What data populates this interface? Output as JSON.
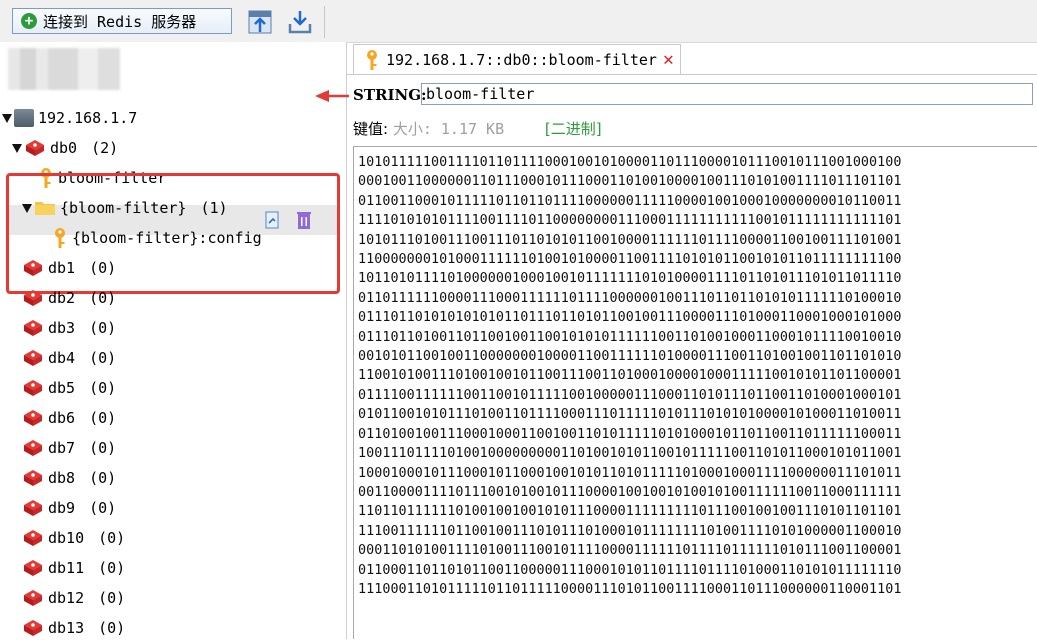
{
  "toolbar": {
    "connect_label": "连接到 Redis 服务器",
    "icons": [
      "plus-circle-icon",
      "import-icon",
      "export-icon"
    ]
  },
  "tree": {
    "server": "192.168.1.7",
    "databases": [
      {
        "name": "db0",
        "count": "(2)"
      },
      {
        "name": "db1",
        "count": "(0)"
      },
      {
        "name": "db2",
        "count": "(0)"
      },
      {
        "name": "db3",
        "count": "(0)"
      },
      {
        "name": "db4",
        "count": "(0)"
      },
      {
        "name": "db5",
        "count": "(0)"
      },
      {
        "name": "db6",
        "count": "(0)"
      },
      {
        "name": "db7",
        "count": "(0)"
      },
      {
        "name": "db8",
        "count": "(0)"
      },
      {
        "name": "db9",
        "count": "(0)"
      },
      {
        "name": "db10",
        "count": "(0)"
      },
      {
        "name": "db11",
        "count": "(0)"
      },
      {
        "name": "db12",
        "count": "(0)"
      },
      {
        "name": "db13",
        "count": "(0)"
      }
    ],
    "key_item": "bloom-filter",
    "folder_item": "{bloom-filter}",
    "folder_count": "(1)",
    "sub_key_item": "{bloom-filter}:config"
  },
  "tab": {
    "title": "192.168.1.7::db0::bloom-filter",
    "close": "✕"
  },
  "detail": {
    "type_label": "STRING:",
    "key_value": "bloom-filter",
    "value_label": "键值:",
    "size_text": "大小: 1.17 KB",
    "format_link": "[二进制]"
  },
  "value_lines": [
    "1010111110011110110111100010010100001101110000101110010111001000100",
    "0001001100000011011100010111000110100100001001110101001111011101101",
    "0110011000101111101101101111000000111110000100100010000000010110011",
    "1111010101011110011110110000000011100011111111111001011111111111101",
    "1010111010011100111011010101100100001111110111100001100100111101001",
    "1100000001010001111110100101000011001111010101100101011011111111100",
    "1011010111101000000100010010111111101010000111101101011101011011110",
    "0110111111000011100011111101111000000100111011011010101111110100010",
    "0111011010101010101101110110101100100111000011101000110001000101000",
    "0111011010011011001001100101010111111001101001000110001011110010010",
    "0010101100100110000000100001100111111010000111001101001001101101010",
    "1100101001110100100101100111001101000100001000111110010101101100001",
    "0111100111111001100101111100100000111000110101110110011010001000101",
    "0101100101011101001101111000111011111010111010101000010100011010011",
    "0110100100111000100011001001101011111010100010110110011011111100011",
    "1001110111101001000000000110100101011001011111001101011000101011001",
    "1000100010111000101100010010101101011111010001000111100000011101011",
    "0011000011110111001010010111000010010010100101001111110011000111111",
    "1101101111110100100100101011100001111111110111001001001110101101101",
    "1110011111101100100111010111010001011111111010011110101000001100010",
    "0001101010011110100111001011110000111111011110111111010111001100001",
    "0110001101101011001100000111000101011011110111101000110101011111110",
    "1110001101011111011011111000011101011001111000110111000000110001101"
  ]
}
